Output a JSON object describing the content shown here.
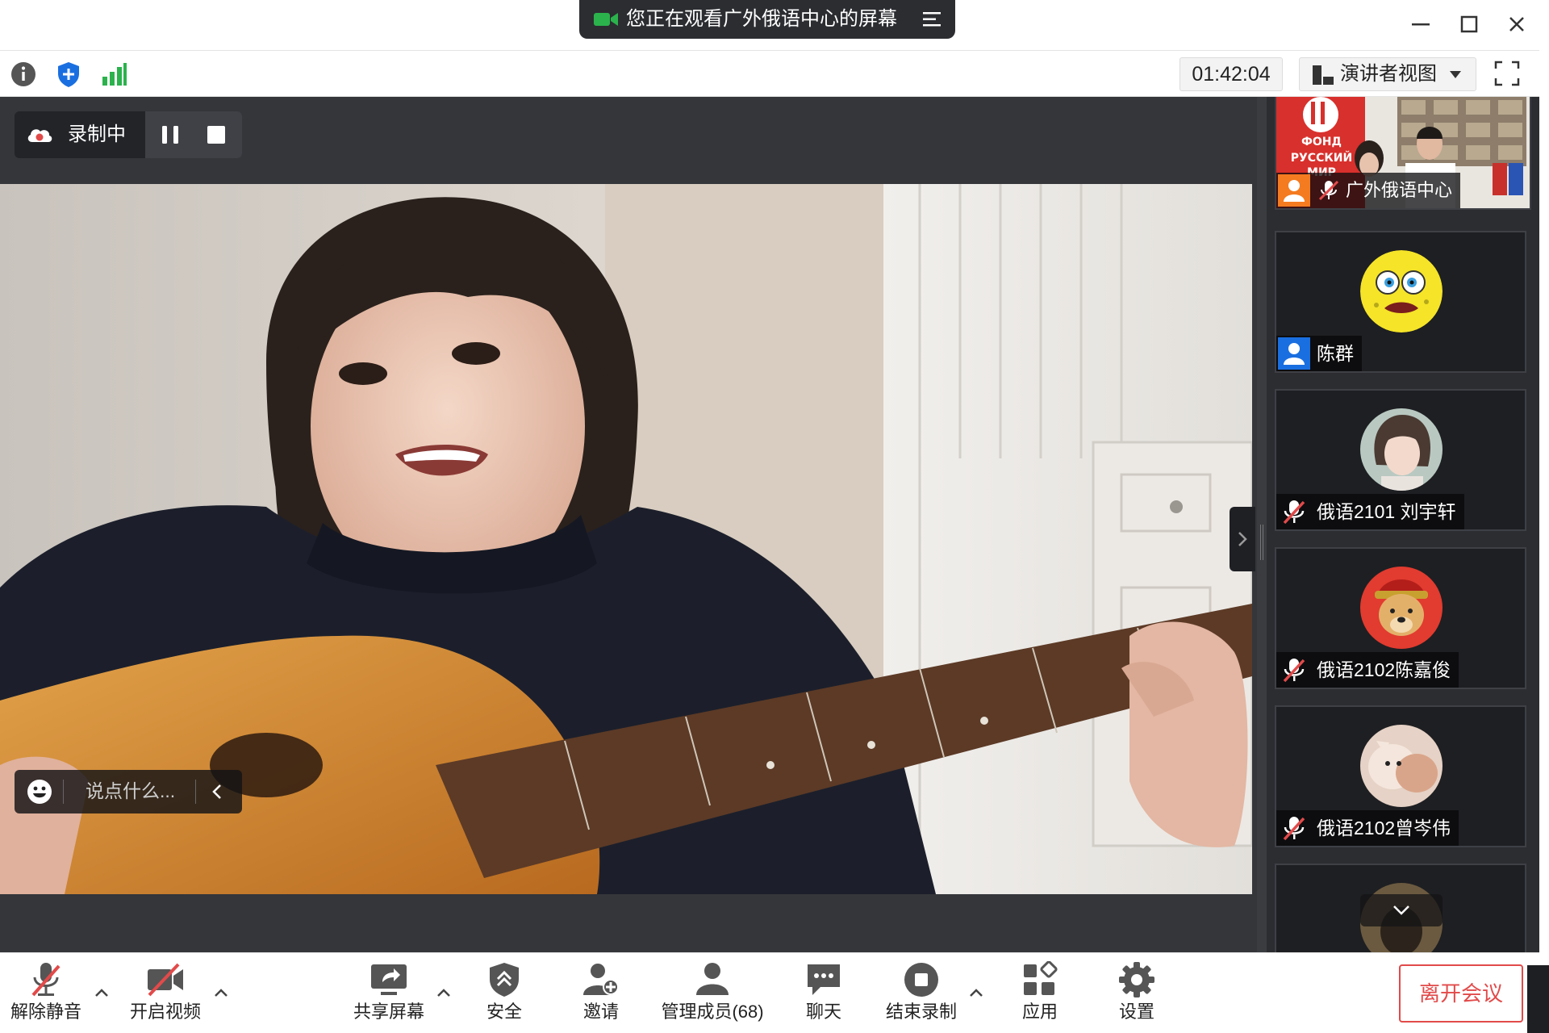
{
  "share_banner": {
    "text": "您正在观看广外俄语中心的屏幕"
  },
  "toolbar": {
    "timer": "01:42:04",
    "view_mode": "演讲者视图"
  },
  "recording": {
    "label": "录制中"
  },
  "chat": {
    "placeholder": "说点什么..."
  },
  "participants": [
    {
      "name": "广外俄语中心",
      "muted": true,
      "video": true
    },
    {
      "name": "陈群",
      "muted": false,
      "video": false
    },
    {
      "name": "俄语2101 刘宇轩",
      "muted": true,
      "video": false
    },
    {
      "name": "俄语2102陈嘉俊",
      "muted": true,
      "video": false
    },
    {
      "name": "俄语2102曾岑伟",
      "muted": true,
      "video": false
    }
  ],
  "shared_logo_text": [
    "ФОНД",
    "РУССКИЙ",
    "МИР"
  ],
  "bottom_bar": {
    "unmute": "解除静音",
    "start_video": "开启视频",
    "share_screen": "共享屏幕",
    "security": "安全",
    "invite": "邀请",
    "manage_members": "管理成员(68)",
    "chat": "聊天",
    "end_recording": "结束录制",
    "apps": "应用",
    "settings": "设置",
    "leave": "离开会议"
  },
  "colors": {
    "accent_red": "#e24a4a",
    "signal_green": "#2bb24c",
    "shield_blue": "#1a6fe0",
    "stage_bg": "#34363a"
  }
}
